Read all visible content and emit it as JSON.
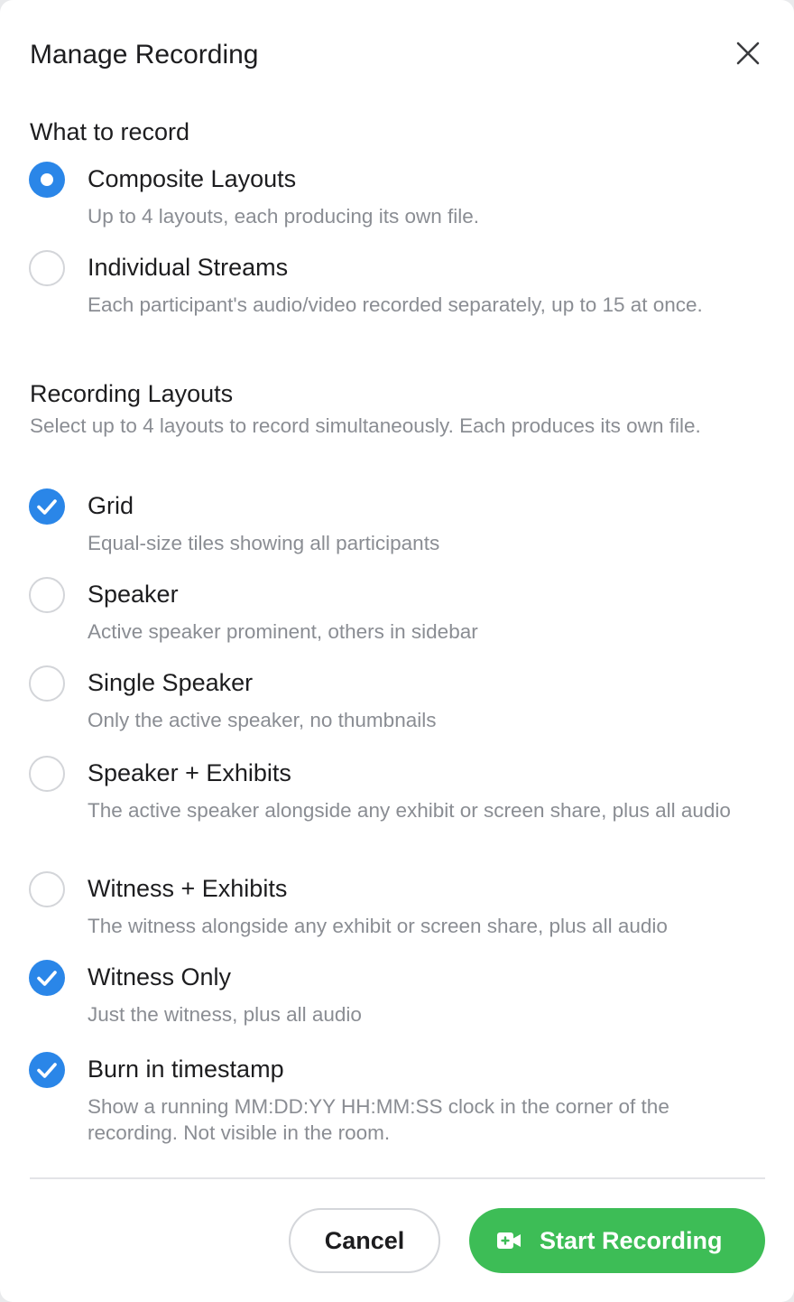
{
  "dialog": {
    "title": "Manage Recording",
    "close_icon": "close-icon"
  },
  "what_to_record": {
    "title": "What to record",
    "options": [
      {
        "label": "Composite Layouts",
        "description": "Up to 4 layouts, each producing its own file.",
        "selected": true
      },
      {
        "label": "Individual Streams",
        "description": "Each participant's audio/video recorded separately, up to 15 at once.",
        "selected": false
      }
    ]
  },
  "recording_layouts": {
    "title": "Recording Layouts",
    "description": "Select up to 4 layouts to record simultaneously. Each produces its own file.",
    "options": [
      {
        "label": "Grid",
        "description": "Equal-size tiles showing all participants",
        "checked": true
      },
      {
        "label": "Speaker",
        "description": "Active speaker prominent, others in sidebar",
        "checked": false
      },
      {
        "label": "Single Speaker",
        "description": "Only the active speaker, no thumbnails",
        "checked": false
      },
      {
        "label": "Speaker + Exhibits",
        "description": "The active speaker alongside any exhibit or screen share, plus all audio",
        "checked": false
      },
      {
        "label": "Witness + Exhibits",
        "description": "The witness alongside any exhibit or screen share, plus all audio",
        "checked": false
      },
      {
        "label": "Witness Only",
        "description": "Just the witness, plus all audio",
        "checked": true
      }
    ]
  },
  "timestamp": {
    "label": "Burn in timestamp",
    "description": "Show a running MM:DD:YY HH:MM:SS clock in the corner of the recording. Not visible in the room.",
    "checked": true
  },
  "footer": {
    "cancel_label": "Cancel",
    "start_label": "Start Recording",
    "start_icon": "video-camera-icon"
  },
  "colors": {
    "accent_blue": "#2a86e8",
    "start_green": "#3dbd56",
    "muted_text": "#8a8d93"
  }
}
